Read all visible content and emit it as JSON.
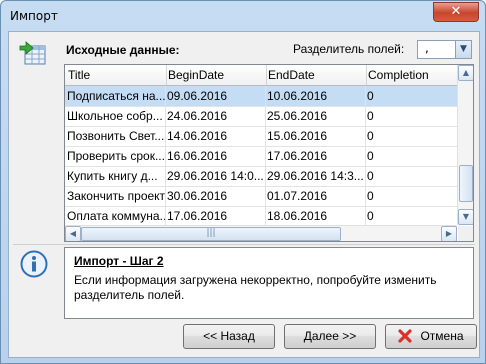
{
  "window": {
    "title": "Импорт",
    "close_glyph": "✕"
  },
  "header": {
    "source_label": "Исходные данные:",
    "separator_label": "Разделитель полей:",
    "separator_value": ","
  },
  "table": {
    "columns": [
      "Title",
      "BeginDate",
      "EndDate",
      "Completion"
    ],
    "rows": [
      [
        "Подписаться на...",
        "09.06.2016",
        "10.06.2016",
        "0"
      ],
      [
        "Школьное собр...",
        "24.06.2016",
        "25.06.2016",
        "0"
      ],
      [
        "Позвонить Свет...",
        "14.06.2016",
        "15.06.2016",
        "0"
      ],
      [
        "Проверить срок...",
        "16.06.2016",
        "17.06.2016",
        "0"
      ],
      [
        "Купить книгу д...",
        "29.06.2016 14:0...",
        "29.06.2016 14:3...",
        "0"
      ],
      [
        "Закончить проект",
        "30.06.2016",
        "01.07.2016",
        "0"
      ],
      [
        "Оплата коммуна...",
        "17.06.2016",
        "18.06.2016",
        "0"
      ]
    ],
    "selected_row": 0
  },
  "info": {
    "title": "Импорт - Шаг 2",
    "text": "Если информация загружена некорректно, попробуйте изменить разделитель полей."
  },
  "buttons": {
    "back": "<< Назад",
    "next": "Далее >>",
    "cancel": "Отмена"
  },
  "icons": {
    "import": "table-import-icon",
    "info": "info-icon",
    "cancel": "red-x-icon"
  },
  "colors": {
    "selected_row": "#c5dcf5",
    "cancel_x": "#d9312b",
    "info_blue": "#2f6fb8"
  }
}
